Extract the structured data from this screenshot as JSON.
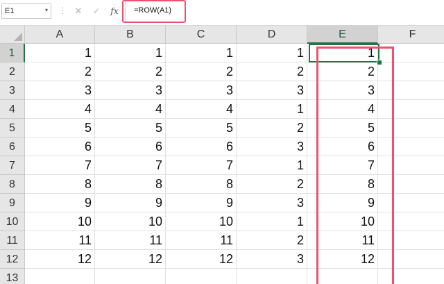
{
  "formula_bar": {
    "name_box": "E1",
    "name_box_arrow": "▾",
    "separator": "⋮",
    "cancel_icon": "✕",
    "enter_icon": "✓",
    "fx_icon": "fx",
    "formula": "=ROW(A1)"
  },
  "highlight_color": "#f0506e",
  "selection_color": "#217346",
  "grid": {
    "columns": [
      "A",
      "B",
      "C",
      "D",
      "E",
      "F"
    ],
    "selected_column": "E",
    "selected_row": "1",
    "selected_cell": "E1",
    "rows": [
      {
        "row": "1",
        "cells": [
          "1",
          "1",
          "1",
          "1",
          "1",
          ""
        ]
      },
      {
        "row": "2",
        "cells": [
          "2",
          "2",
          "2",
          "2",
          "2",
          ""
        ]
      },
      {
        "row": "3",
        "cells": [
          "3",
          "3",
          "3",
          "3",
          "3",
          ""
        ]
      },
      {
        "row": "4",
        "cells": [
          "4",
          "4",
          "4",
          "1",
          "4",
          ""
        ]
      },
      {
        "row": "5",
        "cells": [
          "5",
          "5",
          "5",
          "2",
          "5",
          ""
        ]
      },
      {
        "row": "6",
        "cells": [
          "6",
          "6",
          "6",
          "3",
          "6",
          ""
        ]
      },
      {
        "row": "7",
        "cells": [
          "7",
          "7",
          "7",
          "1",
          "7",
          ""
        ]
      },
      {
        "row": "8",
        "cells": [
          "8",
          "8",
          "8",
          "2",
          "8",
          ""
        ]
      },
      {
        "row": "9",
        "cells": [
          "9",
          "9",
          "9",
          "3",
          "9",
          ""
        ]
      },
      {
        "row": "10",
        "cells": [
          "10",
          "10",
          "10",
          "1",
          "10",
          ""
        ]
      },
      {
        "row": "11",
        "cells": [
          "11",
          "11",
          "11",
          "2",
          "11",
          ""
        ]
      },
      {
        "row": "12",
        "cells": [
          "12",
          "12",
          "12",
          "3",
          "12",
          ""
        ]
      },
      {
        "row": "13",
        "cells": [
          "",
          "",
          "",
          "",
          "",
          ""
        ]
      }
    ]
  }
}
